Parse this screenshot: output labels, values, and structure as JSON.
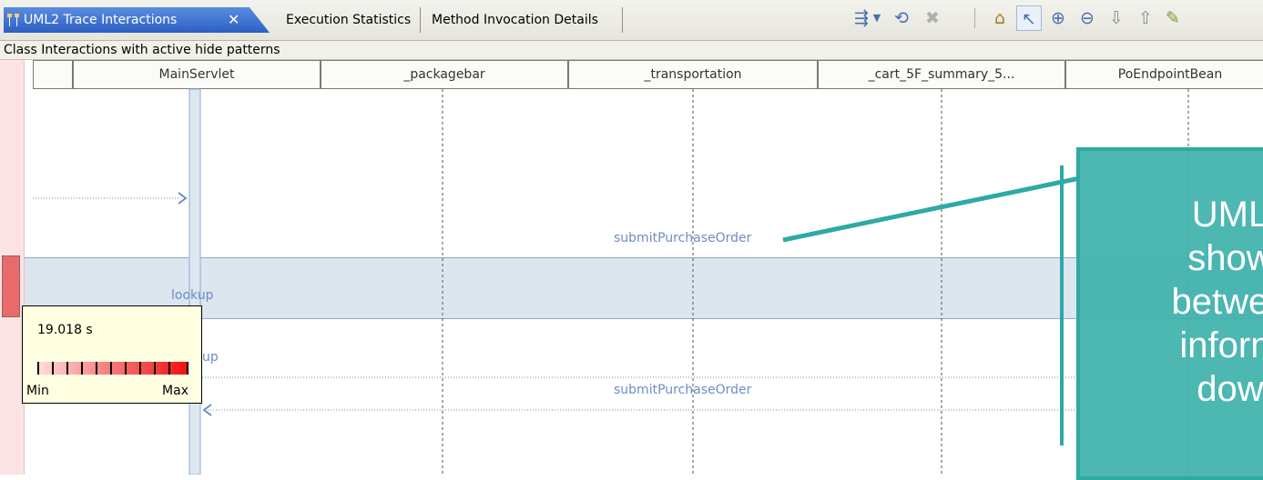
{
  "tabs": {
    "active": "UML2 Trace Interactions",
    "close": "✕",
    "second": "Execution Statistics",
    "third": "Method Invocation Details"
  },
  "toolbar_icons": [
    "filter-icon",
    "dropdown-arrow-icon",
    "refresh-icon",
    "delete-icon",
    "home-icon",
    "select-pointer-icon",
    "zoom-in-icon",
    "zoom-out-icon",
    "arrow-down-icon",
    "arrow-up-icon",
    "highlighter-icon"
  ],
  "subtitle": "Class Interactions with active hide patterns",
  "columns": [
    "MainServlet",
    "_packagebar",
    "_transportation",
    "_cart_5F_summary_5...",
    "PoEndpointBean"
  ],
  "messages": {
    "m1": "submitPurchaseOrder",
    "m2": "lookup",
    "m3": "up",
    "m4": "submitPurchaseOrder"
  },
  "tooltip": {
    "value": "19.018 s",
    "min": "Min",
    "max": "Max"
  },
  "callout": {
    "lines": [
      "UML",
      "show",
      "betwee",
      "inform",
      "dow"
    ]
  },
  "colors": {
    "accent_tab": "#2d5fc4",
    "message_text": "#6d8cc7",
    "highlight_row": "#dbe6ef",
    "callout": "#40b2ac",
    "hotspot": "#e86a6a"
  }
}
